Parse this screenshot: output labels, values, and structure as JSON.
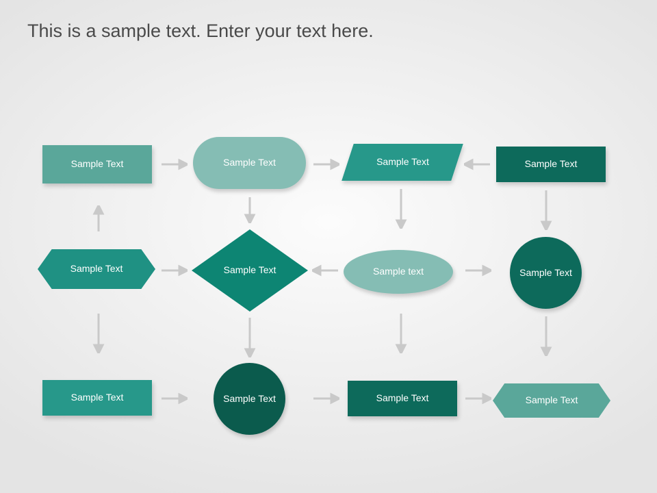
{
  "title": "This is a sample text. Enter your text here.",
  "nodes": {
    "r1c1": "Sample Text",
    "r1c2": "Sample Text",
    "r1c3": "Sample Text",
    "r1c4": "Sample Text",
    "r2c1": "Sample Text",
    "r2c2": "Sample Text",
    "r2c3": "Sample text",
    "r2c4": "Sample Text",
    "r3c1": "Sample Text",
    "r3c2": "Sample Text",
    "r3c3": "Sample Text",
    "r3c4": "Sample Text"
  }
}
